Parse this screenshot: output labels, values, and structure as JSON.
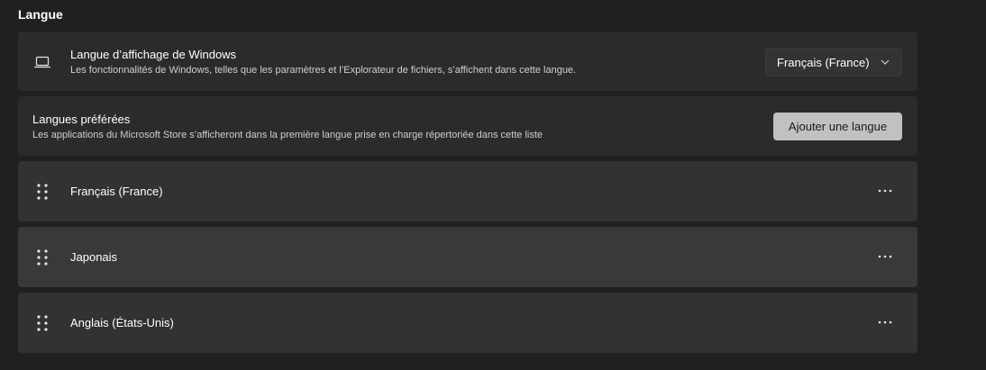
{
  "section": {
    "title": "Langue"
  },
  "display_language": {
    "title": "Langue d’affichage de Windows",
    "description": "Les fonctionnalités de Windows, telles que les paramètres et l’Explorateur de fichiers, s’affichent dans cette langue.",
    "selected": "Français (France)",
    "icon": "monitor-icon"
  },
  "preferred_languages": {
    "title": "Langues préférées",
    "description": "Les applications du Microsoft Store s’afficheront dans la première langue prise en charge répertoriée dans cette liste",
    "add_button": "Ajouter une langue"
  },
  "languages": [
    {
      "name": "Français (France)"
    },
    {
      "name": "Japonais"
    },
    {
      "name": "Anglais (États-Unis)"
    }
  ],
  "colors": {
    "background": "#202020",
    "card": "#2b2b2b",
    "button": "#c2c0c3"
  }
}
